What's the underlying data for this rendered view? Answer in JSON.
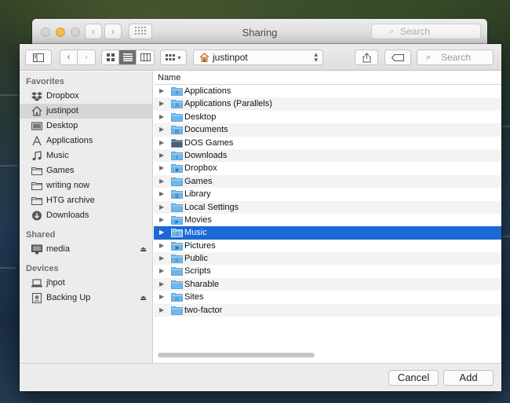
{
  "background_window": {
    "title": "Sharing",
    "search_placeholder": "Search"
  },
  "toolbar": {
    "path_label": "justinpot",
    "search_placeholder": "Search",
    "view_modes": [
      "icon-view",
      "list-view",
      "column-view"
    ],
    "active_view": "list-view"
  },
  "sidebar": {
    "sections": [
      {
        "title": "Favorites",
        "items": [
          {
            "label": "Dropbox",
            "icon": "dropbox-icon"
          },
          {
            "label": "justinpot",
            "icon": "home-icon",
            "selected": true
          },
          {
            "label": "Desktop",
            "icon": "desktop-icon"
          },
          {
            "label": "Applications",
            "icon": "applications-icon"
          },
          {
            "label": "Music",
            "icon": "music-icon"
          },
          {
            "label": "Games",
            "icon": "folder-icon"
          },
          {
            "label": "writing now",
            "icon": "folder-icon"
          },
          {
            "label": "HTG archive",
            "icon": "folder-icon"
          },
          {
            "label": "Downloads",
            "icon": "downloads-icon"
          }
        ]
      },
      {
        "title": "Shared",
        "items": [
          {
            "label": "media",
            "icon": "monitor-icon",
            "eject": true
          }
        ]
      },
      {
        "title": "Devices",
        "items": [
          {
            "label": "jhpot",
            "icon": "laptop-icon"
          },
          {
            "label": "Backing Up",
            "icon": "drive-icon",
            "eject": true
          }
        ]
      }
    ]
  },
  "filelist": {
    "column_header": "Name",
    "rows": [
      {
        "name": "Applications",
        "icon": "applications-folder"
      },
      {
        "name": "Applications (Parallels)",
        "icon": "applications-folder"
      },
      {
        "name": "Desktop",
        "icon": "folder"
      },
      {
        "name": "Documents",
        "icon": "documents-folder"
      },
      {
        "name": "DOS Games",
        "icon": "dark-folder"
      },
      {
        "name": "Downloads",
        "icon": "downloads-folder"
      },
      {
        "name": "Dropbox",
        "icon": "dropbox-folder"
      },
      {
        "name": "Games",
        "icon": "folder"
      },
      {
        "name": "Library",
        "icon": "library-folder"
      },
      {
        "name": "Local Settings",
        "icon": "folder"
      },
      {
        "name": "Movies",
        "icon": "movies-folder"
      },
      {
        "name": "Music",
        "icon": "music-folder",
        "selected": true
      },
      {
        "name": "Pictures",
        "icon": "pictures-folder"
      },
      {
        "name": "Public",
        "icon": "public-folder"
      },
      {
        "name": "Scripts",
        "icon": "folder"
      },
      {
        "name": "Sharable",
        "icon": "folder"
      },
      {
        "name": "Sites",
        "icon": "sites-folder"
      },
      {
        "name": "two-factor",
        "icon": "folder"
      }
    ]
  },
  "footer": {
    "cancel_label": "Cancel",
    "add_label": "Add"
  },
  "colors": {
    "selection": "#1c69d5",
    "folder": "#6fb6ea",
    "sidebar_bg": "#ececec"
  }
}
